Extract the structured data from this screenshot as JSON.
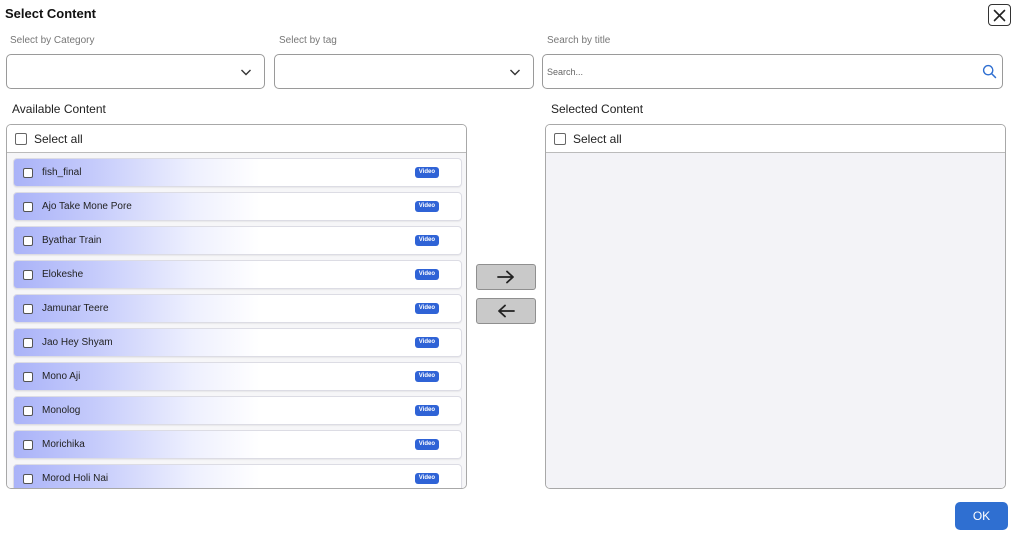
{
  "dialog": {
    "title": "Select Content"
  },
  "filters": {
    "category_label": "Select by Category",
    "category_value": "",
    "tag_label": "Select by tag",
    "tag_value": "",
    "search_label": "Search by title",
    "search_placeholder": "Search..."
  },
  "available": {
    "label": "Available Content",
    "select_all_label": "Select all",
    "items": [
      {
        "name": "fish_final",
        "badge": "Video"
      },
      {
        "name": "Ajo Take Mone Pore",
        "badge": "Video"
      },
      {
        "name": "Byathar Train",
        "badge": "Video"
      },
      {
        "name": "Elokeshe",
        "badge": "Video"
      },
      {
        "name": "Jamunar Teere",
        "badge": "Video"
      },
      {
        "name": "Jao Hey Shyam",
        "badge": "Video"
      },
      {
        "name": "Mono Aji",
        "badge": "Video"
      },
      {
        "name": "Monolog",
        "badge": "Video"
      },
      {
        "name": "Morichika",
        "badge": "Video"
      },
      {
        "name": "Morod Holi Nai",
        "badge": "Video"
      }
    ]
  },
  "selected": {
    "label": "Selected Content",
    "select_all_label": "Select all",
    "items": []
  },
  "actions": {
    "ok_label": "OK"
  },
  "colors": {
    "accent": "#2f6fd1",
    "badge": "#2f63d6",
    "item_gradient_start": "#aab3f8"
  },
  "icons": {
    "close": "close-icon",
    "dropdown": "chevron-down-icon",
    "search": "search-icon",
    "move_right": "arrow-right-icon",
    "move_left": "arrow-left-icon"
  }
}
